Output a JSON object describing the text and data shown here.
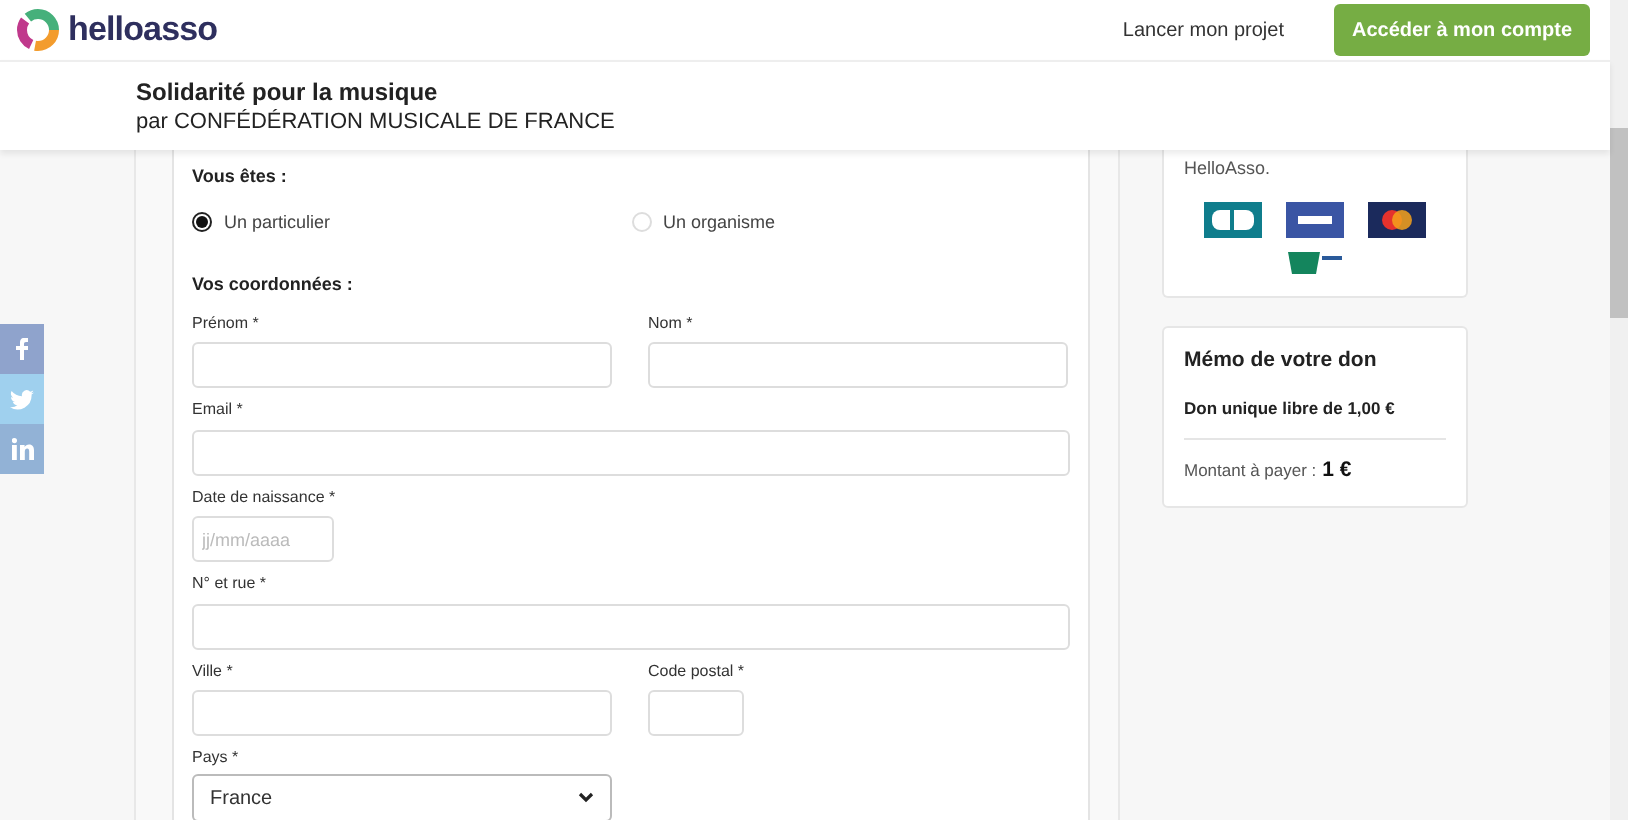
{
  "header": {
    "brand": "helloasso",
    "link": "Lancer mon projet",
    "button": "Accéder à mon compte"
  },
  "campaign": {
    "title": "Solidarité pour la musique",
    "organizer": "par CONFÉDÉRATION MUSICALE DE FRANCE"
  },
  "form": {
    "type_heading": "Vous êtes :",
    "radios": [
      {
        "label": "Un particulier",
        "selected": true
      },
      {
        "label": "Un organisme",
        "selected": false
      }
    ],
    "section_heading": "Vos coordonnées :",
    "rows": [
      [
        {
          "label": "Prénom *",
          "kind": "text"
        },
        {
          "label": "Nom *",
          "kind": "text"
        }
      ],
      [
        {
          "label": "Email *",
          "kind": "wide"
        }
      ],
      [
        {
          "label": "Date de naissance *",
          "kind": "date",
          "placeholder": "jj/mm/aaaa"
        }
      ],
      [
        {
          "label": "N° et rue *",
          "kind": "wide"
        }
      ],
      [
        {
          "label": "Ville *",
          "kind": "text"
        },
        {
          "label": "Code postal *",
          "kind": "postal"
        }
      ],
      [
        {
          "label": "Pays *",
          "kind": "select",
          "value": "France"
        }
      ]
    ]
  },
  "security_card": {
    "text": "HelloAsso."
  },
  "memo": {
    "title": "Mémo de votre don",
    "item": "Don unique libre de 1,00 €",
    "total_label": "Montant à payer :",
    "total": "1 €"
  }
}
